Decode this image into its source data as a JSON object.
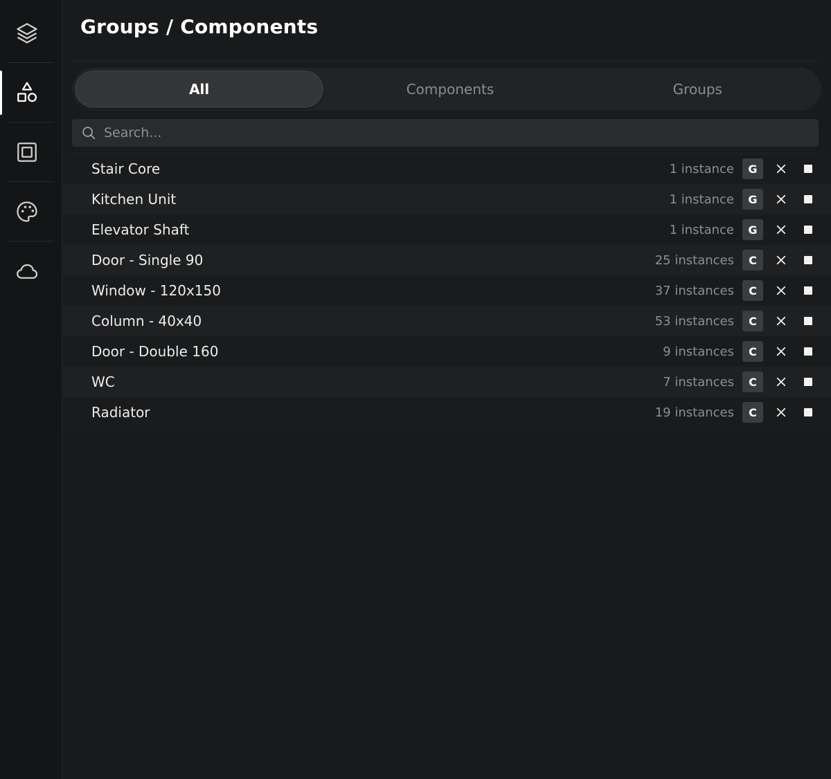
{
  "header": {
    "title": "Groups / Components"
  },
  "sidebar": {
    "items": [
      {
        "icon": "layers-icon",
        "active": false
      },
      {
        "icon": "shapes-icon",
        "active": true
      },
      {
        "icon": "frame-icon",
        "active": false
      },
      {
        "icon": "palette-icon",
        "active": false
      },
      {
        "icon": "cloud-icon",
        "active": false
      }
    ]
  },
  "tabs": [
    {
      "label": "All",
      "active": true
    },
    {
      "label": "Components",
      "active": false
    },
    {
      "label": "Groups",
      "active": false
    }
  ],
  "search": {
    "placeholder": "Search...",
    "value": ""
  },
  "items": [
    {
      "name": "Stair Core",
      "count": "1 instance",
      "type": "G"
    },
    {
      "name": "Kitchen Unit",
      "count": "1 instance",
      "type": "G"
    },
    {
      "name": "Elevator Shaft",
      "count": "1 instance",
      "type": "G"
    },
    {
      "name": "Door - Single 90",
      "count": "25 instances",
      "type": "C"
    },
    {
      "name": "Window - 120x150",
      "count": "37 instances",
      "type": "C"
    },
    {
      "name": "Column - 40x40",
      "count": "53 instances",
      "type": "C"
    },
    {
      "name": "Door - Double 160",
      "count": "9 instances",
      "type": "C"
    },
    {
      "name": "WC",
      "count": "7 instances",
      "type": "C"
    },
    {
      "name": "Radiator",
      "count": "19 instances",
      "type": "C"
    }
  ],
  "colors": {
    "background": "#191a1b",
    "sidebar": "#141516",
    "accent": "#ffffff"
  }
}
